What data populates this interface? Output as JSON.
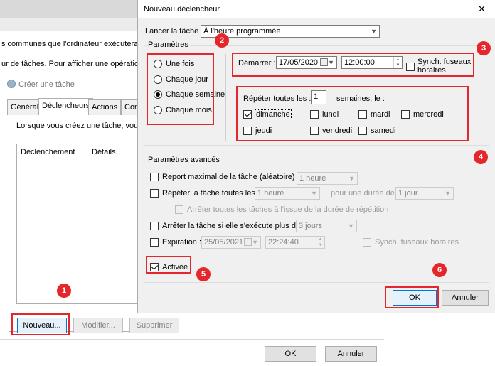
{
  "background_window": {
    "line1": "s communes que l'ordinateur exécutera auto",
    "line2": "ur de tâches. Pour afficher une opération ou",
    "subwindow_title": "Créer une tâche",
    "tabs": [
      "Général",
      "Déclencheurs",
      "Actions",
      "Con"
    ],
    "panel_text": "Lorsque vous créez une tâche, vous po",
    "columns": [
      "Déclenchement",
      "Détails"
    ],
    "buttons": {
      "new": "Nouveau...",
      "modify": "Modifier...",
      "delete": "Supprimer"
    },
    "ok": "OK",
    "cancel": "Annuler"
  },
  "dialog": {
    "title": "Nouveau déclencheur",
    "close": "✕",
    "launch_label": "Lancer la tâche :",
    "launch_value": "À l'heure programmée",
    "params_label": "Paramètres",
    "radios": [
      "Une fois",
      "Chaque jour",
      "Chaque semaine",
      "Chaque mois"
    ],
    "start_label": "Démarrer :",
    "start_date": "17/05/2020",
    "start_time": "12:00:00",
    "sync_tz": "Synch. fuseaux horaires",
    "repeat_label": "Répéter toutes les :",
    "repeat_value": "1",
    "weeks_label": "semaines, le :",
    "days": [
      "dimanche",
      "lundi",
      "mardi",
      "mercredi",
      "jeudi",
      "vendredi",
      "samedi"
    ],
    "advanced_label": "Paramètres avancés",
    "delay_label": "Report maximal de la tâche (aléatoire) :",
    "delay_value": "1 heure",
    "repeat_task_label": "Répéter la tâche toutes les :",
    "repeat_task_value": "1 heure",
    "duration_label": "pour une durée de :",
    "duration_value": "1 jour",
    "stop_all_label": "Arrêter toutes les tâches à l'issue de la durée de répétition",
    "stop_if_label": "Arrêter la tâche si elle s'exécute plus de :",
    "stop_if_value": "3 jours",
    "expire_label": "Expiration :",
    "expire_date": "25/05/2021",
    "expire_time": "22:24:40",
    "expire_sync": "Synch. fuseaux horaires",
    "enabled_label": "Activée",
    "ok": "OK",
    "cancel": "Annuler"
  },
  "badges": [
    "1",
    "2",
    "3",
    "4",
    "5",
    "6"
  ],
  "colors": {
    "annotation_red": "#e5272b",
    "dialog_bg": "#f0f0f0",
    "default_button_border": "#0078d7"
  }
}
